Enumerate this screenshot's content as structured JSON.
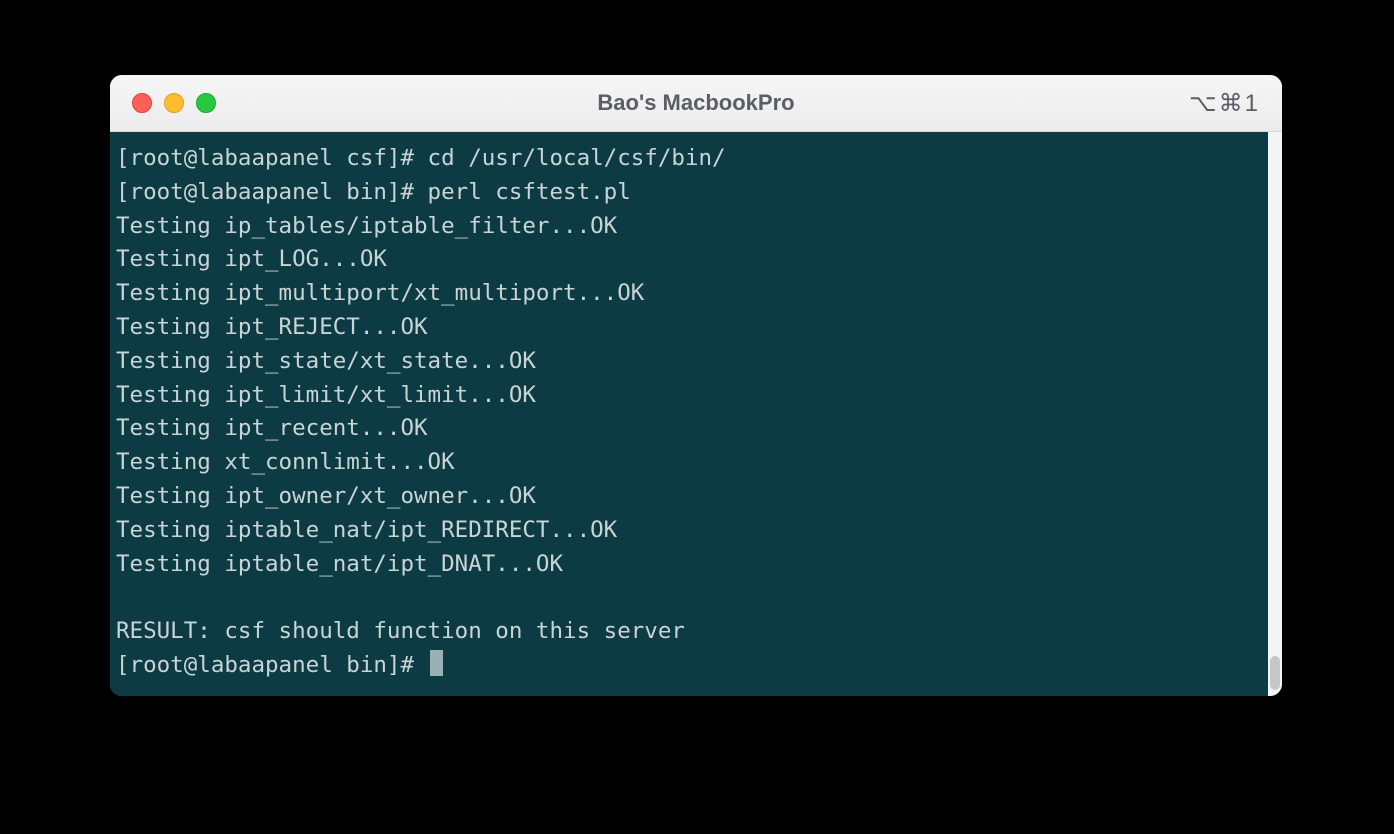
{
  "window": {
    "title": "Bao's MacbookPro",
    "shortcut": "⌥⌘1"
  },
  "terminal": {
    "lines": [
      "[root@labaapanel csf]# cd /usr/local/csf/bin/",
      "[root@labaapanel bin]# perl csftest.pl",
      "Testing ip_tables/iptable_filter...OK",
      "Testing ipt_LOG...OK",
      "Testing ipt_multiport/xt_multiport...OK",
      "Testing ipt_REJECT...OK",
      "Testing ipt_state/xt_state...OK",
      "Testing ipt_limit/xt_limit...OK",
      "Testing ipt_recent...OK",
      "Testing xt_connlimit...OK",
      "Testing ipt_owner/xt_owner...OK",
      "Testing iptable_nat/ipt_REDIRECT...OK",
      "Testing iptable_nat/ipt_DNAT...OK",
      "",
      "RESULT: csf should function on this server"
    ],
    "prompt": "[root@labaapanel bin]# "
  }
}
